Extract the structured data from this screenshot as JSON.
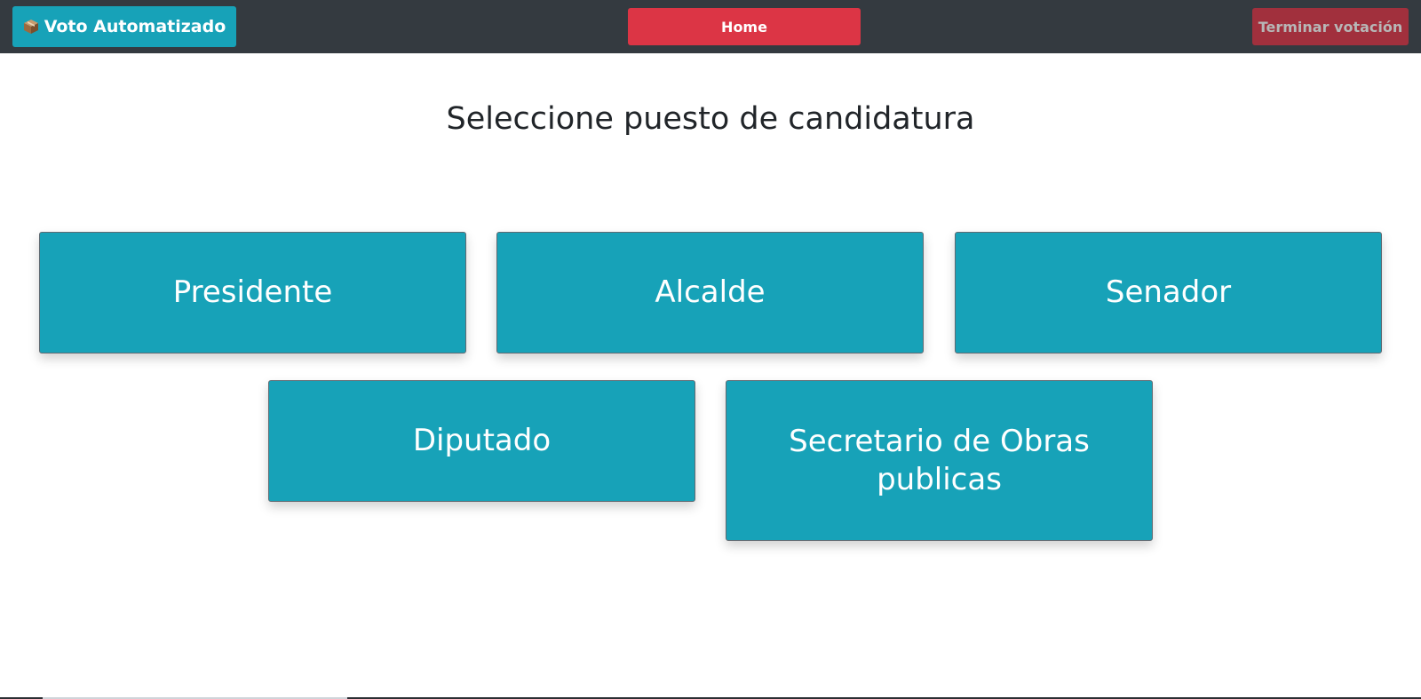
{
  "navbar": {
    "brand_icon": "package-box-icon",
    "brand_label": "Voto Automatizado",
    "home_label": "Home",
    "end_label": "Terminar votación"
  },
  "main": {
    "title": "Seleccione puesto de candidatura",
    "positions": [
      {
        "label": "Presidente"
      },
      {
        "label": "Alcalde"
      },
      {
        "label": "Senador"
      },
      {
        "label": "Diputado"
      },
      {
        "label": "Secretario de Obras publicas"
      }
    ]
  },
  "colors": {
    "navbar_bg": "#343a40",
    "brand_bg": "#17a2b8",
    "home_bg": "#dc3545",
    "end_bg": "#a1303d",
    "card_bg": "#17a2b8"
  }
}
